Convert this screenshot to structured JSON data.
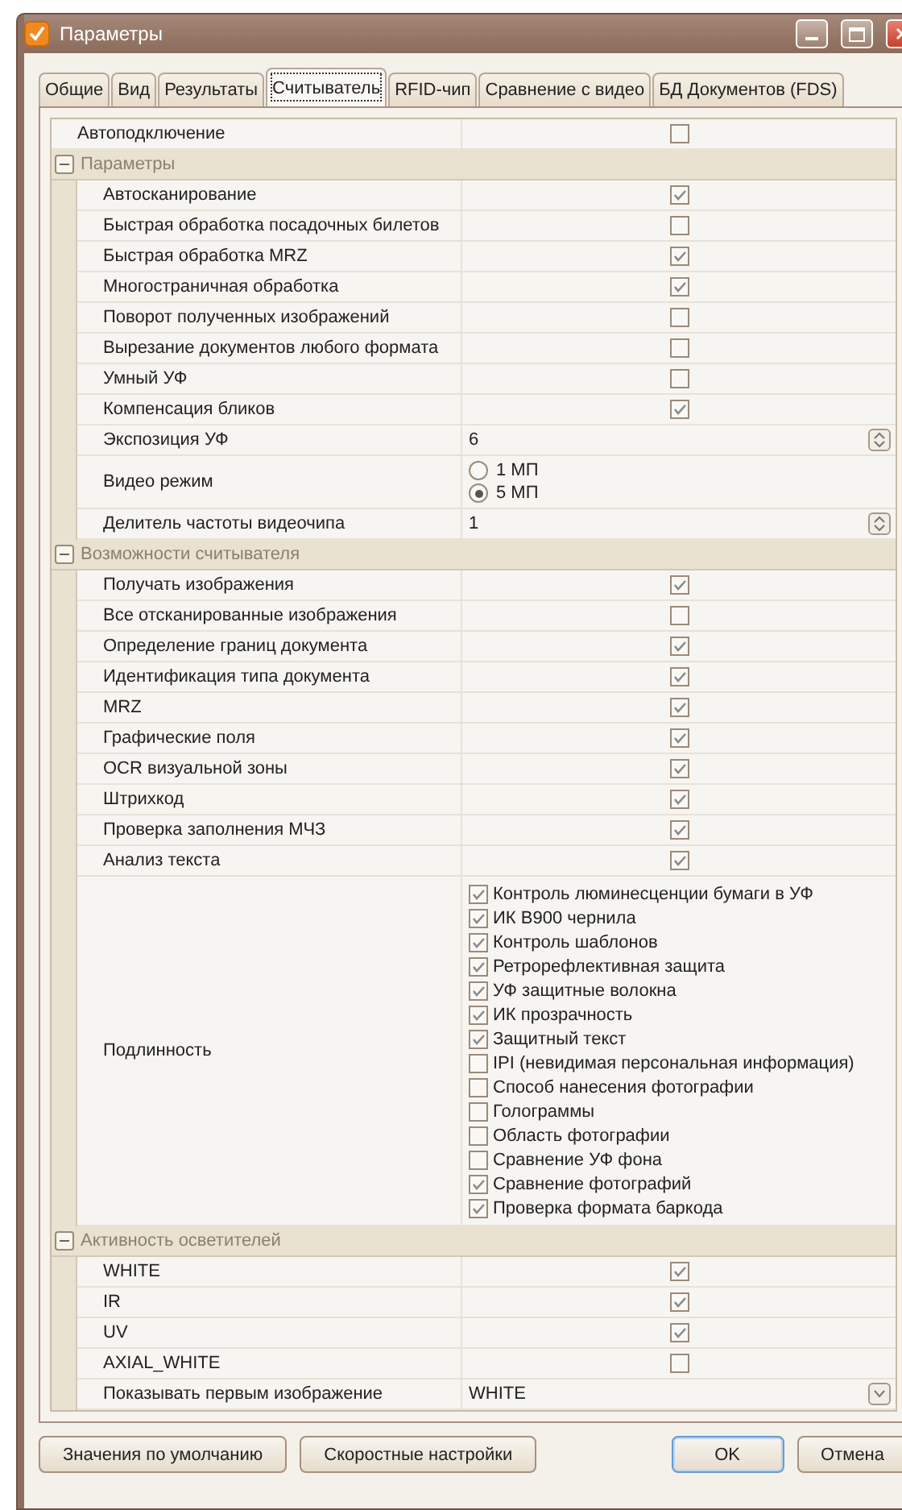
{
  "window": {
    "title": "Параметры"
  },
  "tabs": [
    {
      "label": "Общие",
      "selected": false
    },
    {
      "label": "Вид",
      "selected": false
    },
    {
      "label": "Результаты",
      "selected": false
    },
    {
      "label": "Считыватель",
      "selected": true
    },
    {
      "label": "RFID-чип",
      "selected": false
    },
    {
      "label": "Сравнение с видео",
      "selected": false
    },
    {
      "label": "БД Документов (FDS)",
      "selected": false
    }
  ],
  "grid": {
    "top_rows": [
      {
        "kind": "checkbox",
        "label": "Автоподключение",
        "checked": false
      }
    ],
    "sections": [
      {
        "title": "Параметры",
        "expanded": true,
        "rows": [
          {
            "kind": "checkbox",
            "label": "Автосканирование",
            "checked": true
          },
          {
            "kind": "checkbox",
            "label": "Быстрая обработка посадочных билетов",
            "checked": false
          },
          {
            "kind": "checkbox",
            "label": "Быстрая обработка MRZ",
            "checked": true
          },
          {
            "kind": "checkbox",
            "label": "Многостраничная обработка",
            "checked": true
          },
          {
            "kind": "checkbox",
            "label": "Поворот полученных изображений",
            "checked": false
          },
          {
            "kind": "checkbox",
            "label": "Вырезание документов любого формата",
            "checked": false
          },
          {
            "kind": "checkbox",
            "label": "Умный УФ",
            "checked": false
          },
          {
            "kind": "checkbox",
            "label": "Компенсация бликов",
            "checked": true
          },
          {
            "kind": "spin",
            "label": "Экспозиция УФ",
            "value": "6"
          },
          {
            "kind": "radio",
            "label": "Видео режим",
            "options": [
              {
                "label": "1 МП",
                "selected": false
              },
              {
                "label": "5 МП",
                "selected": true
              }
            ]
          },
          {
            "kind": "spin",
            "label": "Делитель частоты видеочипа",
            "value": "1"
          }
        ]
      },
      {
        "title": "Возможности считывателя",
        "expanded": true,
        "rows": [
          {
            "kind": "checkbox",
            "label": "Получать изображения",
            "checked": true
          },
          {
            "kind": "checkbox",
            "label": "Все отсканированные изображения",
            "checked": false
          },
          {
            "kind": "checkbox",
            "label": "Определение границ документа",
            "checked": true
          },
          {
            "kind": "checkbox",
            "label": "Идентификация типа документа",
            "checked": true
          },
          {
            "kind": "checkbox",
            "label": "MRZ",
            "checked": true
          },
          {
            "kind": "checkbox",
            "label": "Графические поля",
            "checked": true
          },
          {
            "kind": "checkbox",
            "label": "OCR визуальной зоны",
            "checked": true
          },
          {
            "kind": "checkbox",
            "label": "Штрихкод",
            "checked": true
          },
          {
            "kind": "checkbox",
            "label": "Проверка заполнения МЧЗ",
            "checked": true
          },
          {
            "kind": "checkbox",
            "label": "Анализ текста",
            "checked": true
          },
          {
            "kind": "checklist",
            "label": "Подлинность",
            "options": [
              {
                "label": "Контроль люминесценции бумаги в УФ",
                "checked": true
              },
              {
                "label": "ИК B900 чернила",
                "checked": true
              },
              {
                "label": "Контроль шаблонов",
                "checked": true
              },
              {
                "label": "Ретрорефлективная защита",
                "checked": true
              },
              {
                "label": "УФ защитные волокна",
                "checked": true
              },
              {
                "label": "ИК прозрачность",
                "checked": true
              },
              {
                "label": "Защитный текст",
                "checked": true
              },
              {
                "label": "IPI (невидимая персональная информация)",
                "checked": false
              },
              {
                "label": "Способ нанесения фотографии",
                "checked": false
              },
              {
                "label": "Голограммы",
                "checked": false
              },
              {
                "label": "Область фотографии",
                "checked": false
              },
              {
                "label": "Сравнение УФ фона",
                "checked": false
              },
              {
                "label": "Сравнение фотографий",
                "checked": true
              },
              {
                "label": "Проверка формата баркода",
                "checked": true
              }
            ]
          }
        ]
      },
      {
        "title": "Активность осветителей",
        "expanded": true,
        "rows": [
          {
            "kind": "checkbox",
            "label": "WHITE",
            "checked": true
          },
          {
            "kind": "checkbox",
            "label": "IR",
            "checked": true
          },
          {
            "kind": "checkbox",
            "label": "UV",
            "checked": true
          },
          {
            "kind": "checkbox",
            "label": "AXIAL_WHITE",
            "checked": false
          },
          {
            "kind": "dropdown",
            "label": "Показывать первым изображение",
            "value": "WHITE"
          }
        ]
      }
    ]
  },
  "buttons": [
    {
      "label": "Значения по умолчанию",
      "default": false
    },
    {
      "label": "Скоростные настройки",
      "default": false
    },
    {
      "label": "OK",
      "default": true
    },
    {
      "label": "Отмена",
      "default": false
    }
  ]
}
